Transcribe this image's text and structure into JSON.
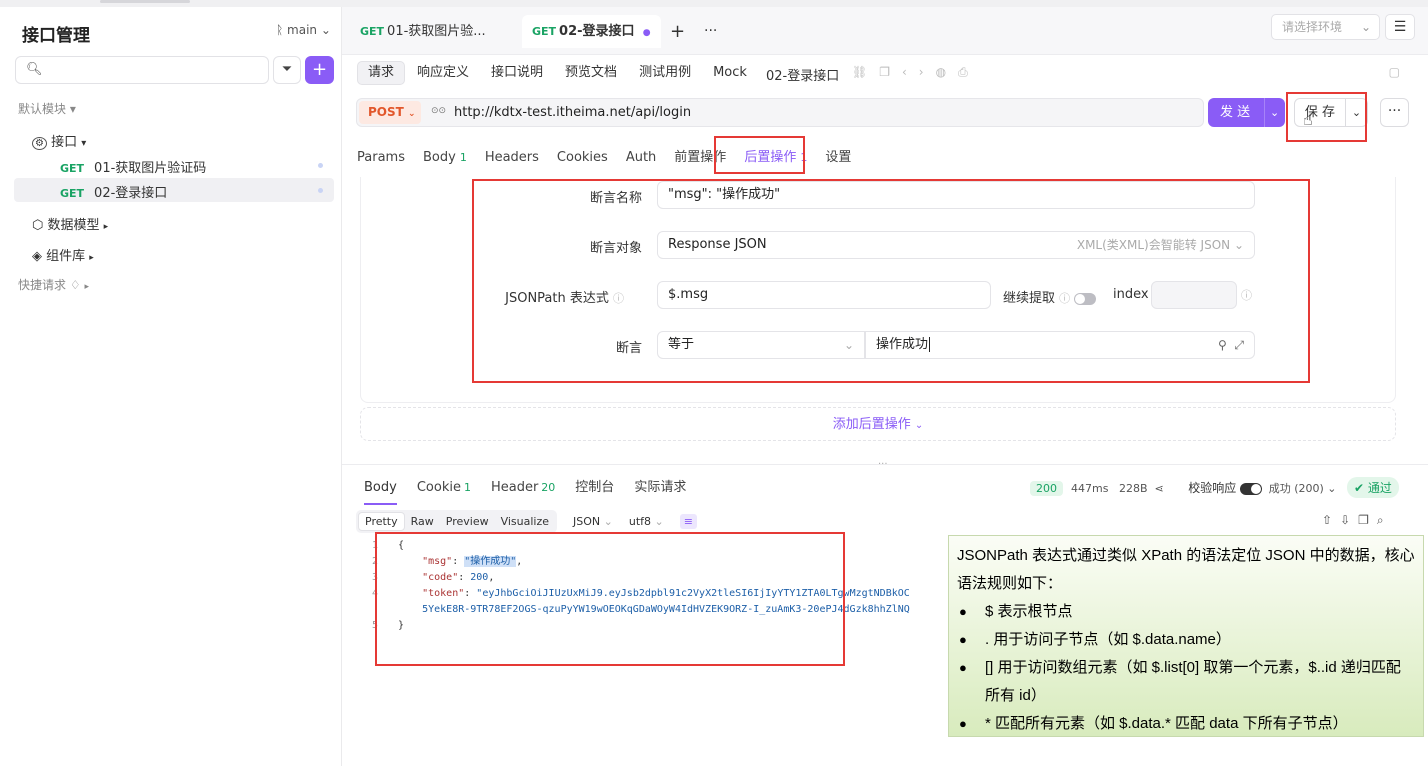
{
  "sidebar": {
    "title": "接口管理",
    "branch": "main",
    "default_module": "默认模块",
    "api_folder": "接口",
    "items": [
      {
        "method": "GET",
        "name": "01-获取图片验证码"
      },
      {
        "method": "GET",
        "name": "02-登录接口"
      }
    ],
    "data_models": "数据模型",
    "components": "组件库",
    "quick_requests": "快捷请求"
  },
  "tabs": [
    {
      "method": "GET",
      "label": "01-获取图片验..."
    },
    {
      "method": "GET",
      "label": "02-登录接口"
    }
  ],
  "env_placeholder": "请选择环境",
  "subtabs": [
    "请求",
    "响应定义",
    "接口说明",
    "预览文档",
    "测试用例",
    "Mock"
  ],
  "endpoint_title": "02-登录接口",
  "request": {
    "method": "POST",
    "url": "http://kdtx-test.itheima.net/api/login",
    "send_label": "发 送",
    "save_label": "保 存"
  },
  "req_tabs": [
    {
      "label": "Params",
      "count": ""
    },
    {
      "label": "Body",
      "count": "1"
    },
    {
      "label": "Headers",
      "count": ""
    },
    {
      "label": "Cookies",
      "count": ""
    },
    {
      "label": "Auth",
      "count": ""
    },
    {
      "label": "前置操作",
      "count": ""
    },
    {
      "label": "后置操作",
      "count": "1"
    },
    {
      "label": "设置",
      "count": ""
    }
  ],
  "assertion": {
    "name_label": "断言名称",
    "name_value": "\"msg\": \"操作成功\"",
    "target_label": "断言对象",
    "target_value": "Response JSON",
    "target_hint": "XML(类XML)会智能转 JSON",
    "jsonpath_label": "JSONPath 表达式",
    "jsonpath_value": "$.msg",
    "continue_label": "继续提取",
    "index_label": "index",
    "assert_label": "断言",
    "operator": "等于",
    "expected": "操作成功"
  },
  "add_post_op": "添加后置操作",
  "response": {
    "tabs": [
      {
        "label": "Body",
        "count": ""
      },
      {
        "label": "Cookie",
        "count": "1"
      },
      {
        "label": "Header",
        "count": "20"
      },
      {
        "label": "控制台",
        "count": ""
      },
      {
        "label": "实际请求",
        "count": ""
      }
    ],
    "status": "200",
    "time": "447ms",
    "size": "228B",
    "verify_label": "校验响应",
    "verify_status": "成功 (200)",
    "pass_label": "通过",
    "formats": [
      "Pretty",
      "Raw",
      "Preview",
      "Visualize"
    ],
    "content_type": "JSON",
    "encoding": "utf8",
    "code_lines": [
      {
        "n": "1",
        "text": "{"
      },
      {
        "n": "2",
        "key": "\"msg\"",
        "val": "\"操作成功\""
      },
      {
        "n": "3",
        "key": "\"code\"",
        "val": "200"
      },
      {
        "n": "4",
        "key": "\"token\"",
        "val": "\"eyJhbGciOiJIUzUxMiJ9.eyJsb2dpbl91c2VyX2tleSI6IjIyYTY1ZTA0LTgwMzgtNDBkOC"
      },
      {
        "n": "",
        "cont": "5YekE8R-9TR78EF2OGS-qzuPyYW19wOEOKqGDaWOyW4IdHVZEK9ORZ-I_zuAmK3-20ePJ4dGzk8hhZlNQ"
      },
      {
        "n": "5",
        "text": "}"
      }
    ]
  },
  "tooltip": {
    "intro": "JSONPath 表达式通过类似 XPath 的语法定位 JSON 中的数据，核心语法规则如下：",
    "rules": [
      "$ 表示根节点",
      ". 用于访问子节点（如 $.data.name）",
      "[] 用于访问数组元素（如 $.list[0] 取第一个元素，$..id 递归匹配所有 id）",
      "* 匹配所有元素（如 $.data.* 匹配 data 下所有子节点）"
    ]
  },
  "colors": {
    "accent": "#8a5cf6",
    "get": "#1aa364",
    "post": "#e2572b",
    "annotation": "#e53935"
  }
}
